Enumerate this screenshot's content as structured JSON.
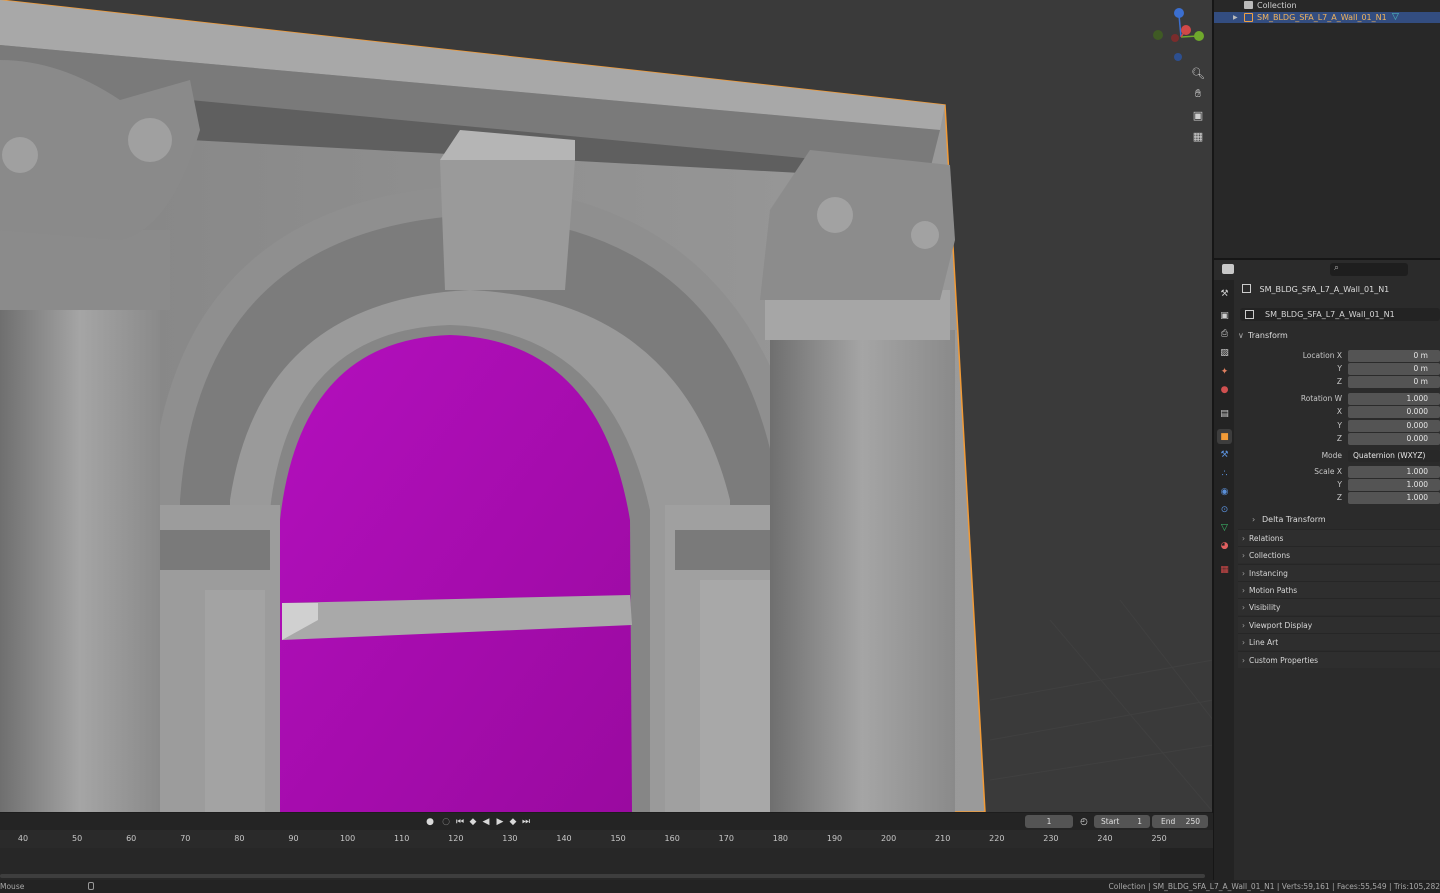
{
  "colors": {
    "accent_selected": "#334d80",
    "missing_texture": "#a20aa8",
    "mesh": "#8e8e8e",
    "outline": "#f29b37"
  },
  "outliner": {
    "collection_label": "Collection",
    "object_label": "SM_BLDG_SFA_L7_A_Wall_01_N1"
  },
  "properties": {
    "object_name": "SM_BLDG_SFA_L7_A_Wall_01_N1",
    "data_name": "SM_BLDG_SFA_L7_A_Wall_01_N1",
    "transform_label": "Transform",
    "location": {
      "label_x": "Location X",
      "label_y": "Y",
      "label_z": "Z",
      "x": "0 m",
      "y": "0 m",
      "z": "0 m"
    },
    "rotation": {
      "label_w": "Rotation W",
      "label_x": "X",
      "label_y": "Y",
      "label_z": "Z",
      "w": "1.000",
      "x": "0.000",
      "y": "0.000",
      "z": "0.000"
    },
    "mode": {
      "label": "Mode",
      "value": "Quaternion (WXYZ)"
    },
    "scale": {
      "label_x": "Scale X",
      "label_y": "Y",
      "label_z": "Z",
      "x": "1.000",
      "y": "1.000",
      "z": "1.000"
    },
    "delta_transform": "Delta Transform",
    "panels": [
      "Relations",
      "Collections",
      "Instancing",
      "Motion Paths",
      "Visibility",
      "Viewport Display",
      "Line Art",
      "Custom Properties"
    ]
  },
  "timeline": {
    "current_frame": "1",
    "start_label": "Start",
    "start_value": "1",
    "end_label": "End",
    "end_value": "250",
    "ticks": [
      "40",
      "50",
      "60",
      "70",
      "80",
      "90",
      "100",
      "110",
      "120",
      "130",
      "140",
      "150",
      "160",
      "170",
      "180",
      "190",
      "200",
      "210",
      "220",
      "230",
      "240",
      "250"
    ]
  },
  "statusbar": {
    "left": "Mouse",
    "right": "Collection | SM_BLDG_SFA_L7_A_Wall_01_N1 | Verts:59,161 | Faces:55,549 | Tris:105,282"
  },
  "icons": [
    "zoom-icon",
    "hand-pan-icon",
    "camera-icon",
    "grid-icon"
  ]
}
